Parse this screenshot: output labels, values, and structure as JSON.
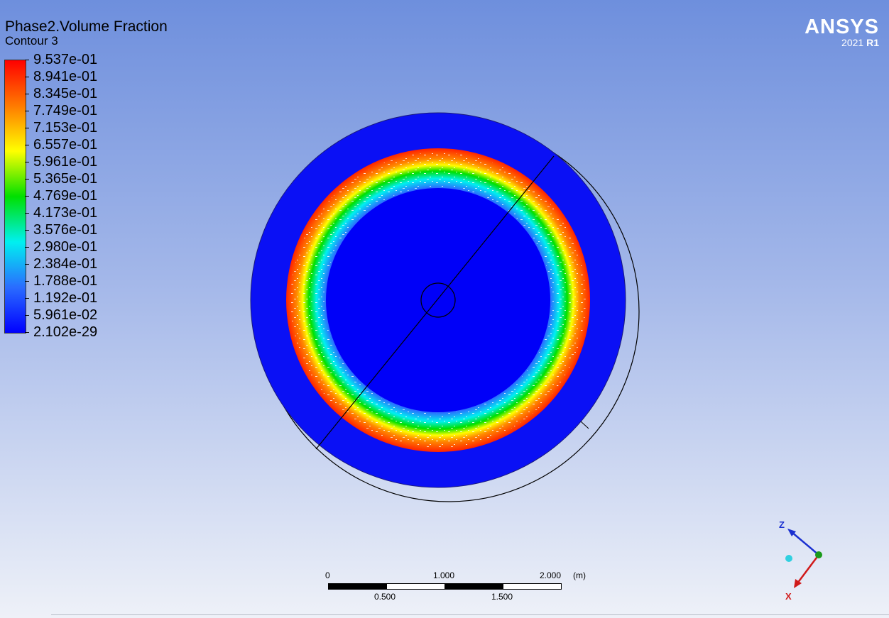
{
  "header": {
    "title": "Phase2.Volume Fraction",
    "subtitle": "Contour 3"
  },
  "logo": {
    "brand": "ANSYS",
    "year": "2021",
    "release": "R1"
  },
  "legend": {
    "values": [
      "9.537e-01",
      "8.941e-01",
      "8.345e-01",
      "7.749e-01",
      "7.153e-01",
      "6.557e-01",
      "5.961e-01",
      "5.365e-01",
      "4.769e-01",
      "4.173e-01",
      "3.576e-01",
      "2.980e-01",
      "2.384e-01",
      "1.788e-01",
      "1.192e-01",
      "5.961e-02",
      "2.102e-29"
    ],
    "colors": [
      "#ff0000",
      "#ff7a00",
      "#ffff00",
      "#00e000",
      "#00f0f0",
      "#2a6cff",
      "#0000ff"
    ]
  },
  "scale_bar": {
    "top_labels": [
      "0",
      "1.000",
      "2.000"
    ],
    "bottom_labels": [
      "0.500",
      "1.500"
    ],
    "unit": "(m)"
  },
  "axes": {
    "z_label": "Z",
    "x_label": "X"
  }
}
